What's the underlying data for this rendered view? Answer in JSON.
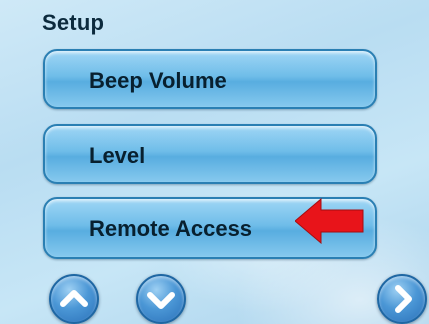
{
  "screen": {
    "title": "Setup"
  },
  "menu": {
    "items": [
      {
        "label": "Beep Volume"
      },
      {
        "label": "Level"
      },
      {
        "label": "Remote Access"
      }
    ]
  },
  "annotation": {
    "icon": "red-left-arrow",
    "color": "#e8141a"
  },
  "navigation": {
    "up_icon": "chevron-up-icon",
    "down_icon": "chevron-down-icon",
    "next_icon": "chevron-right-icon",
    "button_color": "#3f8ed3"
  }
}
